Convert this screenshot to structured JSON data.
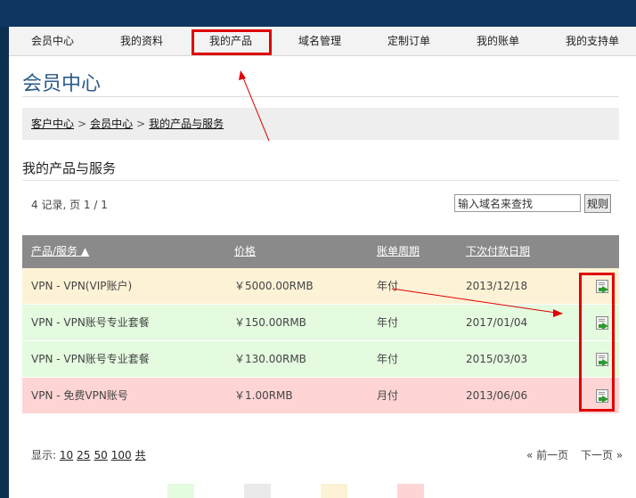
{
  "nav": {
    "items": [
      {
        "label": "会员中心"
      },
      {
        "label": "我的资料"
      },
      {
        "label": "我的产品"
      },
      {
        "label": "域名管理"
      },
      {
        "label": "定制订单"
      },
      {
        "label": "我的账单"
      },
      {
        "label": "我的支持单"
      }
    ],
    "active": "我的产品"
  },
  "header": {
    "title": "会员中心"
  },
  "breadcrumb": {
    "items": [
      "客户中心",
      "会员中心",
      "我的产品与服务"
    ],
    "separator": ">"
  },
  "section": {
    "title": "我的产品与服务"
  },
  "records": {
    "text": "4 记录, 页 1 / 1"
  },
  "search": {
    "placeholder": "输入域名来查找",
    "value": "输入域名来查找",
    "button_label": "规则"
  },
  "table": {
    "columns": [
      "产品/服务 ▲",
      "价格",
      "账单周期",
      "下次付款日期"
    ],
    "rows": [
      {
        "product": "VPN - VPN(VIP账户)",
        "price": "￥5000.00RMB",
        "cycle": "年付",
        "next_due": "2013/12/18",
        "status_color": "#fdf2d6"
      },
      {
        "product": "VPN - VPN账号专业套餐",
        "price": "￥150.00RMB",
        "cycle": "年付",
        "next_due": "2017/01/04",
        "status_color": "#e4fbe0"
      },
      {
        "product": "VPN - VPN账号专业套餐",
        "price": "￥130.00RMB",
        "cycle": "年付",
        "next_due": "2015/03/03",
        "status_color": "#e4fbe0"
      },
      {
        "product": "VPN - 免费VPN账号",
        "price": "￥1.00RMB",
        "cycle": "月付",
        "next_due": "2013/06/06",
        "status_color": "#ffd4d4"
      }
    ],
    "action_icon": "view-details-icon"
  },
  "pagination": {
    "show_label": "显示:",
    "sizes": [
      "10",
      "25",
      "50",
      "100",
      "共"
    ],
    "prev_label": "« 前一页",
    "next_label": "下一页 »"
  },
  "colors": {
    "annotation": "#e00000",
    "header_bg": "#8a8a8a",
    "title_blue": "#2c5b8a",
    "status_active": "#e4fbe0",
    "status_pending": "#fdf2d6",
    "status_terminated": "#ffd4d4",
    "status_other": "#eaeaea"
  }
}
